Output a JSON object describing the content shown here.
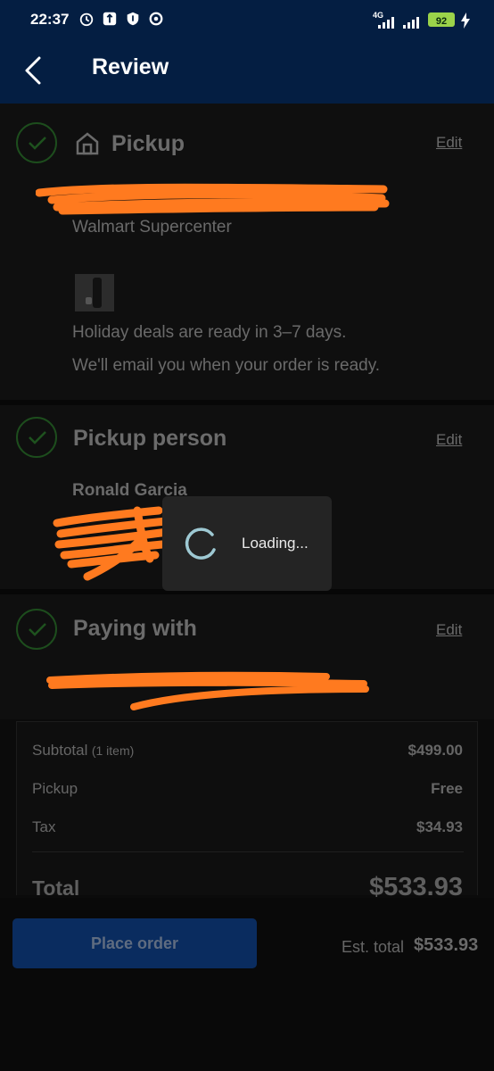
{
  "status_bar": {
    "time": "22:37",
    "network": "4G",
    "battery": "92"
  },
  "header": {
    "title": "Review"
  },
  "pickup": {
    "title": "Pickup",
    "edit": "Edit",
    "store": "Walmart Supercenter",
    "ready_text": "Holiday deals are ready in 3–7 days.",
    "email_text": "We'll email you when your order is ready."
  },
  "pickup_person": {
    "title": "Pickup person",
    "edit": "Edit",
    "name": "Ronald Garcia"
  },
  "paying_with": {
    "title": "Paying with",
    "edit": "Edit"
  },
  "summary": {
    "subtotal_label": "Subtotal",
    "subtotal_items": "(1 item)",
    "subtotal_value": "$499.00",
    "pickup_label": "Pickup",
    "pickup_value": "Free",
    "tax_label": "Tax",
    "tax_value": "$34.93",
    "total_label": "Total",
    "total_value": "$533.93"
  },
  "footer": {
    "place_order": "Place order",
    "est_label": "Est. total",
    "est_value": "$533.93"
  },
  "loading": {
    "text": "Loading..."
  },
  "colors": {
    "brand_navy": "#041e42",
    "accent_blue": "#0a2c5f",
    "redaction_orange": "#ff7a1f",
    "check_green": "#1d4d1d"
  }
}
